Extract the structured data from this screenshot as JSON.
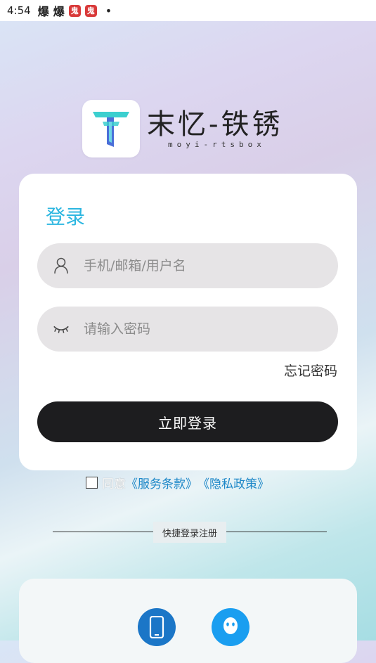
{
  "status_bar": {
    "time": "4:54",
    "icons": [
      "爆",
      "爆"
    ],
    "badges": [
      "鬼",
      "鬼"
    ],
    "dot": "•"
  },
  "brand": {
    "name": "末忆-铁锈",
    "subtitle": "moyi-rtsbox",
    "accent_top": "#3ccfcf",
    "accent_bottom": "#4a6fd8"
  },
  "login": {
    "title": "登录",
    "username_placeholder": "手机/邮箱/用户名",
    "username_value": "",
    "password_placeholder": "请输入密码",
    "password_value": "",
    "forgot_label": "忘记密码",
    "submit_label": "立即登录"
  },
  "agreement": {
    "prefix": "同意",
    "terms_label": "《服务条款》",
    "privacy_label": "《隐私政策》",
    "checked": false
  },
  "divider": {
    "label": "快捷登录注册"
  },
  "quick_login": {
    "items": [
      {
        "icon": "phone-icon",
        "color": "#1b76c7"
      },
      {
        "icon": "qq-icon",
        "color": "#1a9ef0"
      }
    ]
  }
}
